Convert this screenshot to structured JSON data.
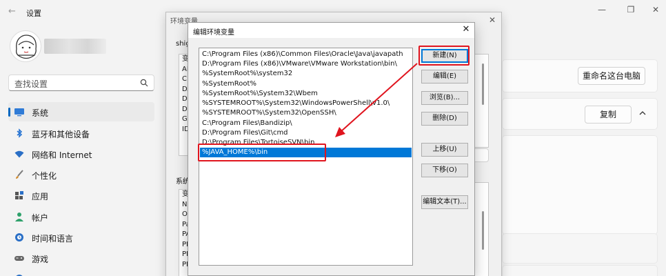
{
  "settings": {
    "title": "设置",
    "search_placeholder": "查找设置",
    "nav": [
      {
        "label": "系统",
        "icon": "monitor-icon",
        "active": true
      },
      {
        "label": "蓝牙和其他设备",
        "icon": "bluetooth-icon"
      },
      {
        "label": "网络和 Internet",
        "icon": "wifi-icon"
      },
      {
        "label": "个性化",
        "icon": "brush-icon"
      },
      {
        "label": "应用",
        "icon": "apps-icon"
      },
      {
        "label": "帐户",
        "icon": "person-icon"
      },
      {
        "label": "时间和语言",
        "icon": "globe-clock-icon"
      },
      {
        "label": "游戏",
        "icon": "gamepad-icon"
      }
    ],
    "rename_button": "重命名这台电脑",
    "copy_button": "复制"
  },
  "env_dialog": {
    "title": "环境变量",
    "user_label": "shig",
    "system_label": "系统",
    "user_rows": [
      "变",
      "AP",
      "CL",
      "DA",
      "DE",
      "DL",
      "GO",
      "ID"
    ],
    "system_rows": [
      "变",
      "NU",
      "OS",
      "Pa",
      "PA",
      "PR",
      "PR",
      "PR"
    ]
  },
  "edit_dialog": {
    "title": "编辑环境变量",
    "paths": [
      "C:\\Program Files (x86)\\Common Files\\Oracle\\Java\\javapath",
      "D:\\Program Files (x86)\\VMware\\VMware Workstation\\bin\\",
      "%SystemRoot%\\system32",
      "%SystemRoot%",
      "%SystemRoot%\\System32\\Wbem",
      "%SYSTEMROOT%\\System32\\WindowsPowerShell\\v1.0\\",
      "%SYSTEMROOT%\\System32\\OpenSSH\\",
      "C:\\Program Files\\Bandizip\\",
      "D:\\Program Files\\Git\\cmd",
      "D:\\Program Files\\TortoiseSVN\\bin",
      "%JAVA_HOME%\\bin"
    ],
    "selected_index": 10,
    "buttons": {
      "new": "新建(N)",
      "edit": "编辑(E)",
      "browse": "浏览(B)...",
      "delete": "删除(D)",
      "move_up": "上移(U)",
      "move_down": "下移(O)",
      "edit_text": "编辑文本(T)..."
    }
  },
  "colors": {
    "accent": "#0078d7",
    "highlight": "#e0141e",
    "nav_indicator": "#0067c0"
  }
}
